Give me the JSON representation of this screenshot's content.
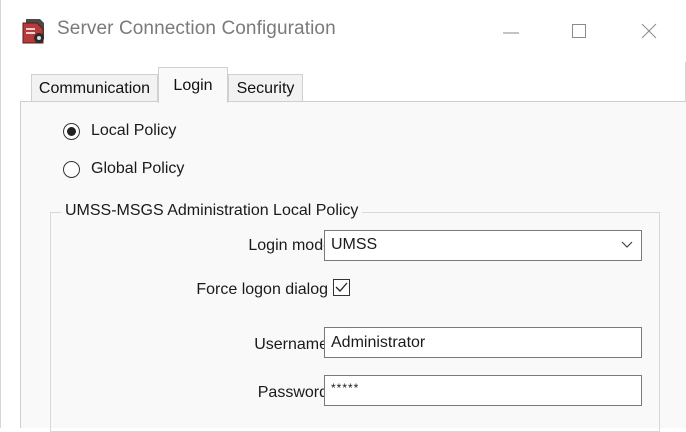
{
  "window": {
    "title": "Server Connection Configuration",
    "icon": "server-settings-icon",
    "controls": [
      "minimize-icon",
      "maximize-icon",
      "close-icon"
    ]
  },
  "tabs": [
    {
      "label": "Communication",
      "selected": false
    },
    {
      "label": "Login",
      "selected": true
    },
    {
      "label": "Security",
      "selected": false
    }
  ],
  "policy": {
    "options": [
      {
        "label": "Local Policy",
        "checked": true
      },
      {
        "label": "Global Policy",
        "checked": false
      }
    ]
  },
  "group": {
    "title": "UMSS-MSGS Administration Local Policy",
    "login_mode": {
      "label": "Login mode",
      "value": "UMSS"
    },
    "force_logon": {
      "label": "Force logon dialog",
      "checked": true
    },
    "username": {
      "label": "Username",
      "value": "Administrator"
    },
    "password": {
      "label": "Password",
      "value": "*****"
    }
  }
}
